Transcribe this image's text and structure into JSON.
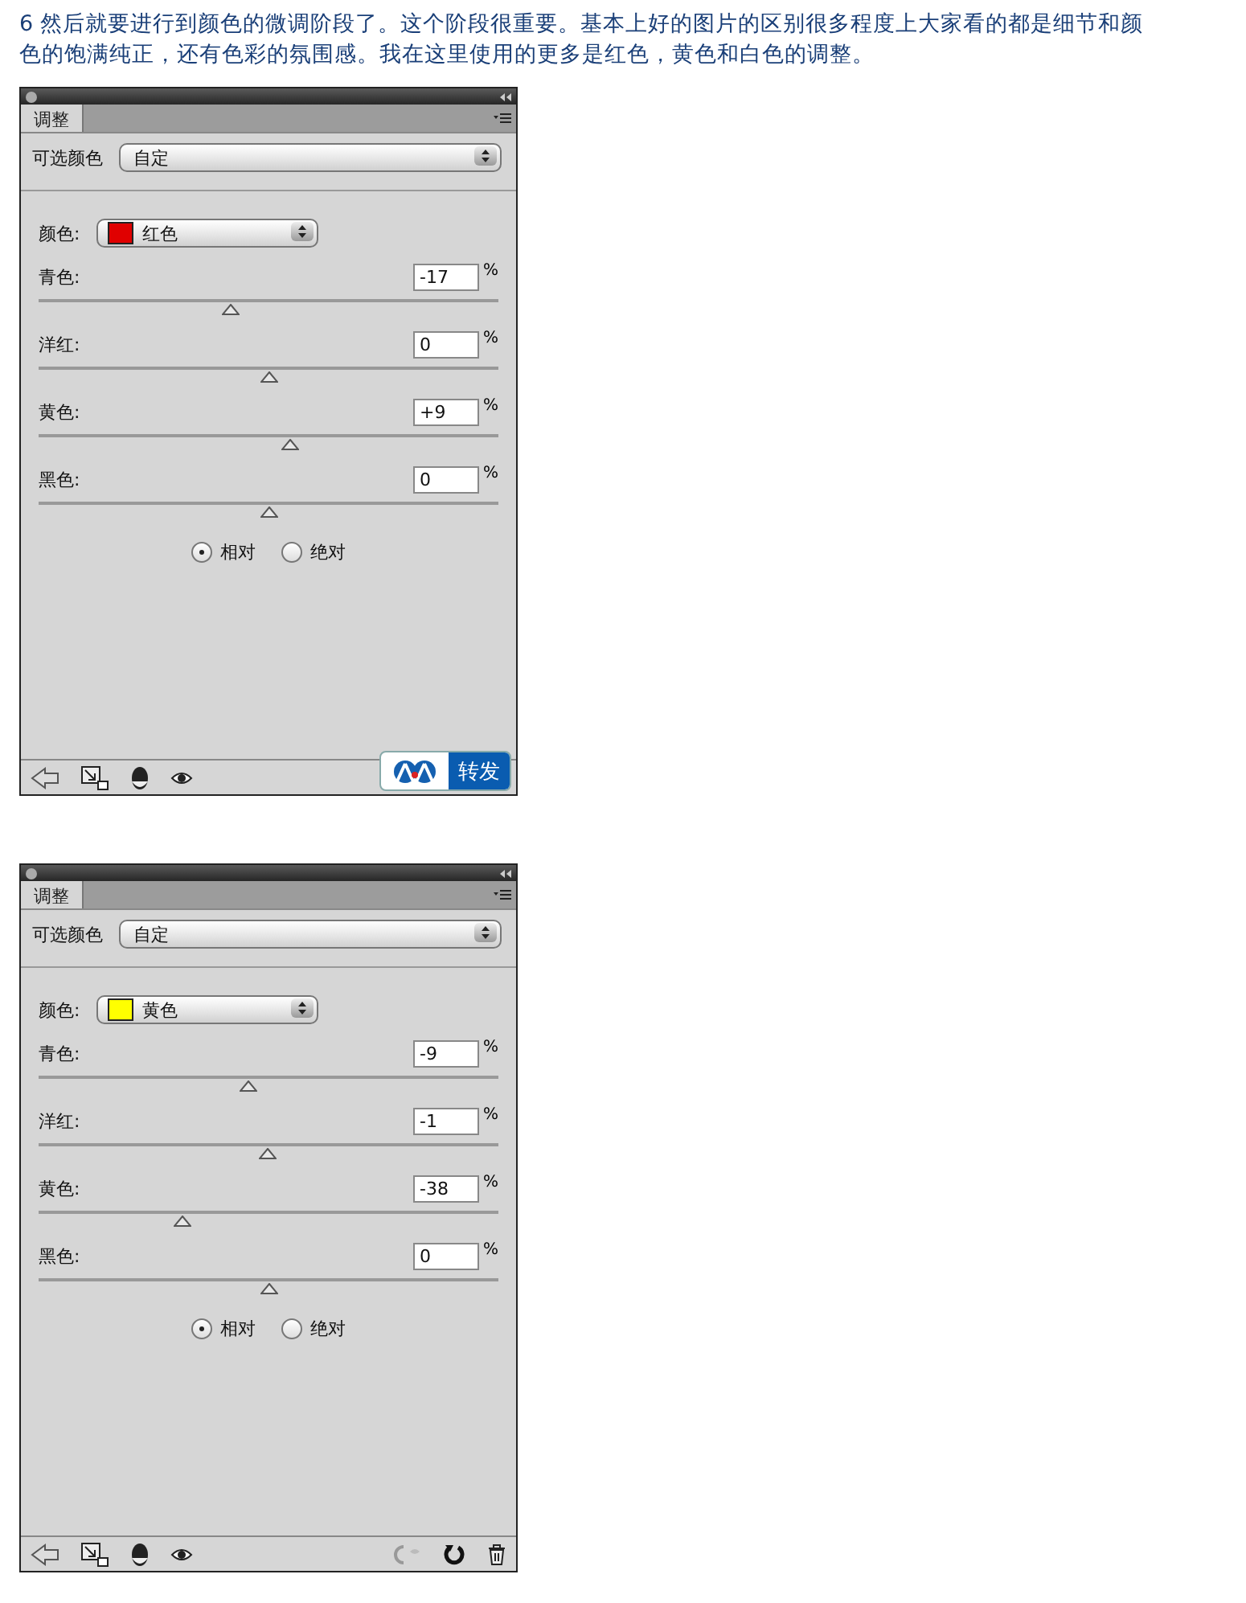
{
  "intro": "6 然后就要进行到颜色的微调阶段了。这个阶段很重要。基本上好的图片的区别很多程度上大家看的都是细节和颜色的饱满纯正，还有色彩的氛围感。我在这里使用的更多是红色，黄色和白色的调整。",
  "panels": [
    {
      "tab": {
        "label": "调整",
        "selected": true
      },
      "preset_label": "可选颜色",
      "preset_value": "自定",
      "color_label": "颜色:",
      "color": {
        "label": "红色",
        "color": "#e00000"
      },
      "sliders": [
        {
          "label": "青色:",
          "value": "-17",
          "unit": "%",
          "level": 0.415
        },
        {
          "label": "洋红:",
          "value": "0",
          "unit": "%",
          "level": 0.5
        },
        {
          "label": "黄色:",
          "value": "+9",
          "unit": "%",
          "level": 0.545
        },
        {
          "label": "黑色:",
          "value": "0",
          "unit": "%",
          "level": 0.5
        }
      ],
      "method": [
        {
          "label": "相对",
          "selected": true
        },
        {
          "label": "绝对",
          "selected": false
        }
      ],
      "share_button": {
        "label": "转发"
      }
    },
    {
      "tab": {
        "label": "调整",
        "selected": true
      },
      "preset_label": "可选颜色",
      "preset_value": "自定",
      "color_label": "颜色:",
      "color": {
        "label": "黄色",
        "color": "#ffff00"
      },
      "sliders": [
        {
          "label": "青色:",
          "value": "-9",
          "unit": "%",
          "level": 0.455
        },
        {
          "label": "洋红:",
          "value": "-1",
          "unit": "%",
          "level": 0.495
        },
        {
          "label": "黄色:",
          "value": "-38",
          "unit": "%",
          "level": 0.31
        },
        {
          "label": "黑色:",
          "value": "0",
          "unit": "%",
          "level": 0.5
        }
      ],
      "method": [
        {
          "label": "相对",
          "selected": true
        },
        {
          "label": "绝对",
          "selected": false
        }
      ]
    }
  ]
}
